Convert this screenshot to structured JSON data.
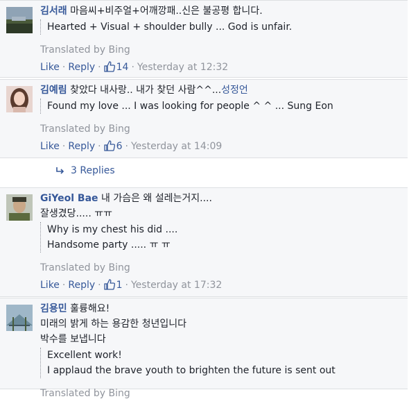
{
  "comments": [
    {
      "author": "김서래",
      "text_lines": [
        "마음씨+비주얼+어깨깡패..신은 불공평 합니다."
      ],
      "mention": "",
      "translation_lines": [
        "Hearted + Visual + shoulder bully ... God is unfair."
      ],
      "translated_by": "Translated by Bing",
      "like": "Like",
      "reply": "Reply",
      "likes": "14",
      "timestamp": "Yesterday at 12:32",
      "avatar_icon": "landscape-photo-avatar"
    },
    {
      "author": "김예림",
      "text_lines": [
        "찾았다 내사랑.. 내가 찾던 사람^^..."
      ],
      "mention": "성정언",
      "translation_lines": [
        "Found my love ... I was looking for people ^ ^ ... Sung Eon"
      ],
      "translated_by": "Translated by Bing",
      "like": "Like",
      "reply": "Reply",
      "likes": "6",
      "timestamp": "Yesterday at 14:09",
      "avatar_icon": "woman-portrait-avatar"
    },
    {
      "author": "GiYeol Bae",
      "text_lines": [
        "내 가슴은 왜 설레는거지....",
        "잘생겼당..... ㅠㅠ"
      ],
      "mention": "",
      "translation_lines": [
        "Why is my chest his did ....",
        "Handsome party ..... ㅠ ㅠ"
      ],
      "translated_by": "Translated by Bing",
      "like": "Like",
      "reply": "Reply",
      "likes": "1",
      "timestamp": "Yesterday at 17:32",
      "avatar_icon": "soldier-portrait-avatar"
    },
    {
      "author": "김용민",
      "text_lines": [
        "훌륭해요!",
        "미래의 밝게 하는 용감한 청년입니다",
        "박수를 보냅니다"
      ],
      "mention": "",
      "translation_lines": [
        "Excellent work!",
        "I applaud the brave youth to brighten the future is sent out"
      ],
      "translated_by": "Translated by Bing",
      "avatar_icon": "bridge-photo-avatar"
    }
  ],
  "replies_link": "3 Replies",
  "colors": {
    "link": "#365899",
    "meta": "#90949c",
    "background": "#f6f7f9",
    "border": "#dddfe2"
  }
}
